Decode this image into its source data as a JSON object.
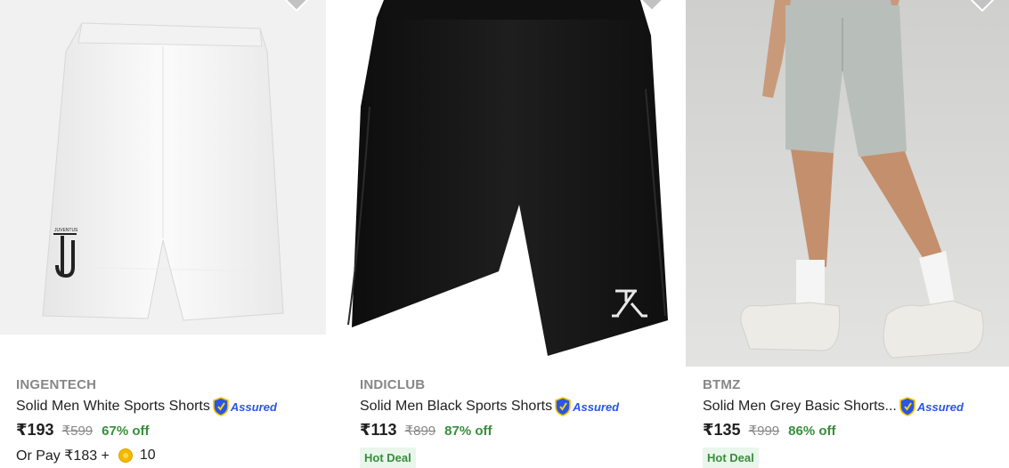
{
  "products": [
    {
      "brand": "INGENTECH",
      "title": "Solid Men White Sports Shorts",
      "assured_label": "Assured",
      "price": "₹193",
      "mrp": "₹599",
      "discount": "67% off",
      "pay_prefix": "Or Pay ₹183 +",
      "coins": "10",
      "image_icon": "white-sports-shorts-image",
      "logo_text": "JUVENTUS"
    },
    {
      "brand": "INDICLUB",
      "title": "Solid Men Black Sports Shorts",
      "assured_label": "Assured",
      "price": "₹113",
      "mrp": "₹899",
      "discount": "87% off",
      "badge": "Hot Deal",
      "image_icon": "black-sports-shorts-image"
    },
    {
      "brand": "BTMZ",
      "title": "Solid Men Grey Basic Shorts...",
      "assured_label": "Assured",
      "price": "₹135",
      "mrp": "₹999",
      "discount": "86% off",
      "badge": "Hot Deal",
      "image_icon": "grey-basic-shorts-model-image"
    }
  ],
  "colors": {
    "brand_text": "#878787",
    "discount_green": "#388e3c",
    "assured_blue": "#2a55e5",
    "hot_deal_bg": "#e9f6ec"
  }
}
